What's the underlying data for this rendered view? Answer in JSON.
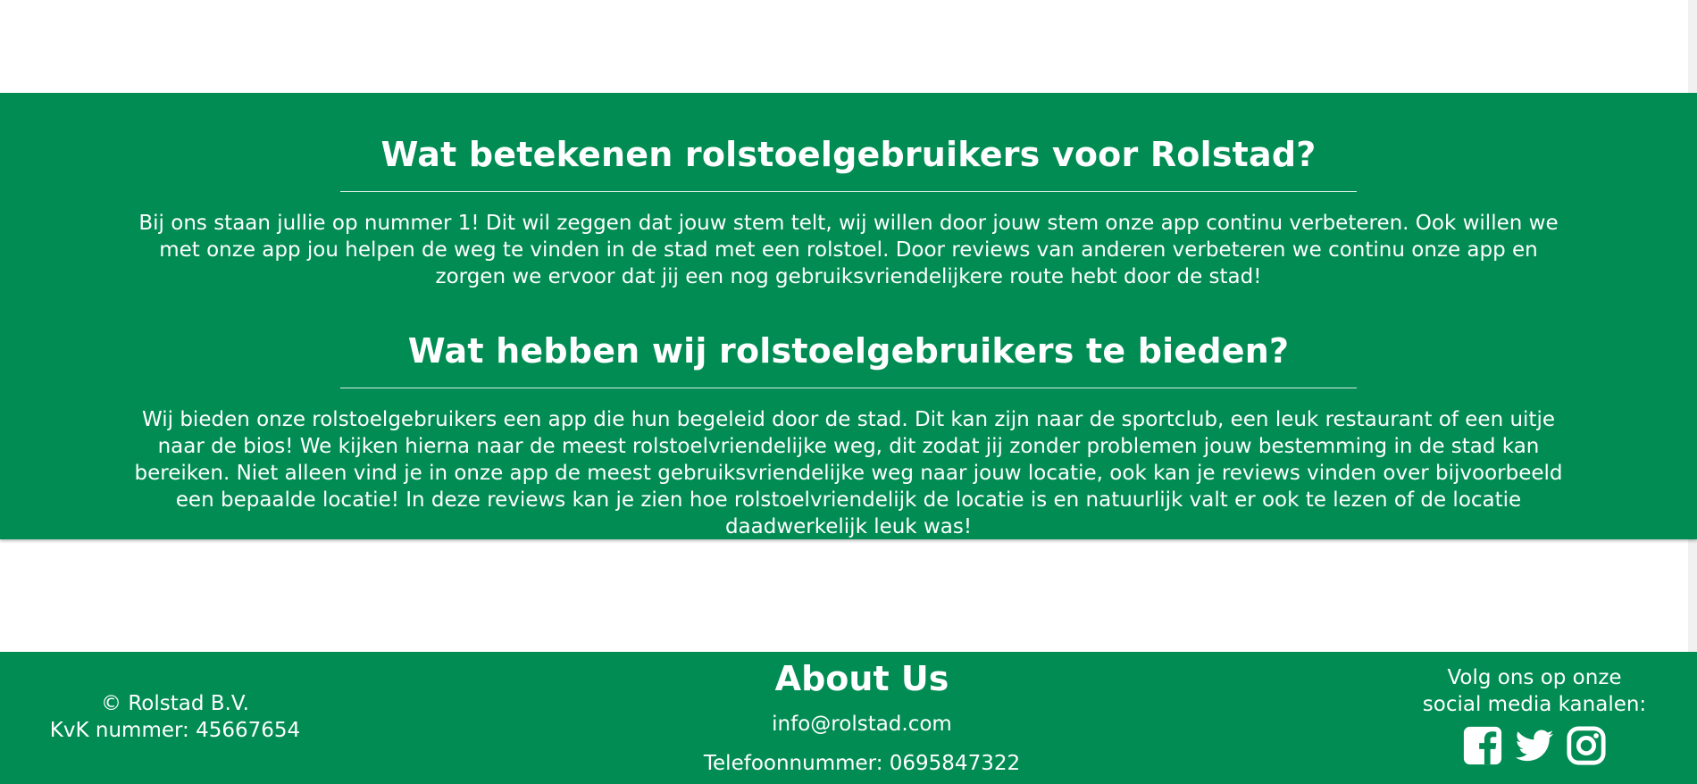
{
  "colors": {
    "brand_green": "#008c53",
    "text": "#ffffff"
  },
  "section1": {
    "title": "Wat betekenen rolstoelgebruikers voor Rolstad?",
    "body": "Bij ons staan jullie op nummer 1! Dit wil zeggen dat jouw stem telt, wij willen door jouw stem onze app continu verbeteren. Ook willen we met onze app jou helpen de weg te vinden in de stad met een rolstoel. Door reviews van anderen verbeteren we continu onze app en zorgen we ervoor dat jij een nog gebruiksvriendelijkere route hebt door de stad!"
  },
  "section2": {
    "title": "Wat hebben wij rolstoelgebruikers te bieden?",
    "body": "Wij bieden onze rolstoelgebruikers een app die hun begeleid door de stad. Dit kan zijn naar de sportclub, een leuk restaurant of een uitje naar de bios! We kijken hierna naar de meest rolstoelvriendelijke weg, dit zodat jij zonder problemen jouw bestemming in de stad kan bereiken. Niet alleen vind je in onze app de meest gebruiksvriendelijke weg naar jouw locatie, ook kan je reviews vinden over bijvoorbeeld een bepaalde locatie! In deze reviews kan je zien hoe rolstoelvriendelijk de locatie is en natuurlijk valt er ook te lezen of de locatie daadwerkelijk leuk was!"
  },
  "footer": {
    "copyright": "© Rolstad B.V.",
    "kvk": "KvK nummer: 45667654",
    "about_title": "About Us",
    "email": "info@rolstad.com",
    "phone": "Telefoonnummer: 0695847322",
    "social_line1": "Volg ons op onze",
    "social_line2": "social media kanalen:",
    "social_icons": [
      "facebook-icon",
      "twitter-icon",
      "instagram-icon"
    ]
  }
}
